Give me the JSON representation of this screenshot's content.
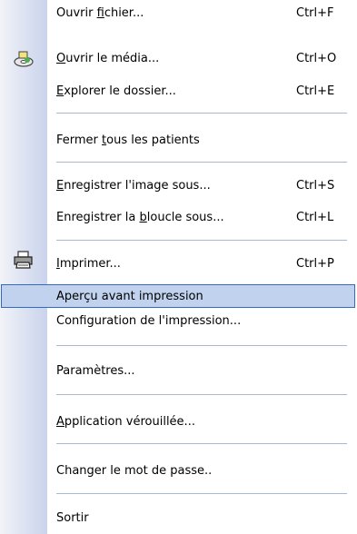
{
  "menu": {
    "items": [
      {
        "pre": "Ouvrir ",
        "acc": "f",
        "post": "ichier...",
        "shortcut": "Ctrl+F"
      },
      {
        "pre": "",
        "acc": "O",
        "post": "uvrir le média...",
        "shortcut": "Ctrl+O",
        "icon": "open-media-icon"
      },
      {
        "pre": "",
        "acc": "E",
        "post": "xplorer le dossier...",
        "shortcut": "Ctrl+E"
      },
      {
        "pre": "Fermer ",
        "acc": "t",
        "post": "ous les patients",
        "shortcut": ""
      },
      {
        "pre": "",
        "acc": "E",
        "post": "nregistrer l'image sous...",
        "shortcut": "Ctrl+S"
      },
      {
        "pre": "Enregistrer la ",
        "acc": "b",
        "post": "loucle sous...",
        "shortcut": "Ctrl+L"
      },
      {
        "pre": "",
        "acc": "I",
        "post": "mprimer...",
        "shortcut": "Ctrl+P",
        "icon": "printer-icon"
      },
      {
        "pre": "Aperçu avant impression",
        "acc": "",
        "post": "",
        "shortcut": "",
        "highlighted": true
      },
      {
        "pre": "Configuration de l'impression...",
        "acc": "",
        "post": "",
        "shortcut": ""
      },
      {
        "pre": "Paramètres...",
        "acc": "",
        "post": "",
        "shortcut": ""
      },
      {
        "pre": "",
        "acc": "A",
        "post": "pplication vérouillée...",
        "shortcut": ""
      },
      {
        "pre": "Changer le mot de passe..",
        "acc": "",
        "post": "",
        "shortcut": ""
      },
      {
        "pre": "Sortir",
        "acc": "",
        "post": "",
        "shortcut": ""
      }
    ]
  },
  "colors": {
    "highlight_bg": "#c1d2ee",
    "highlight_border": "#316ac5",
    "separator": "#a6b9da"
  }
}
